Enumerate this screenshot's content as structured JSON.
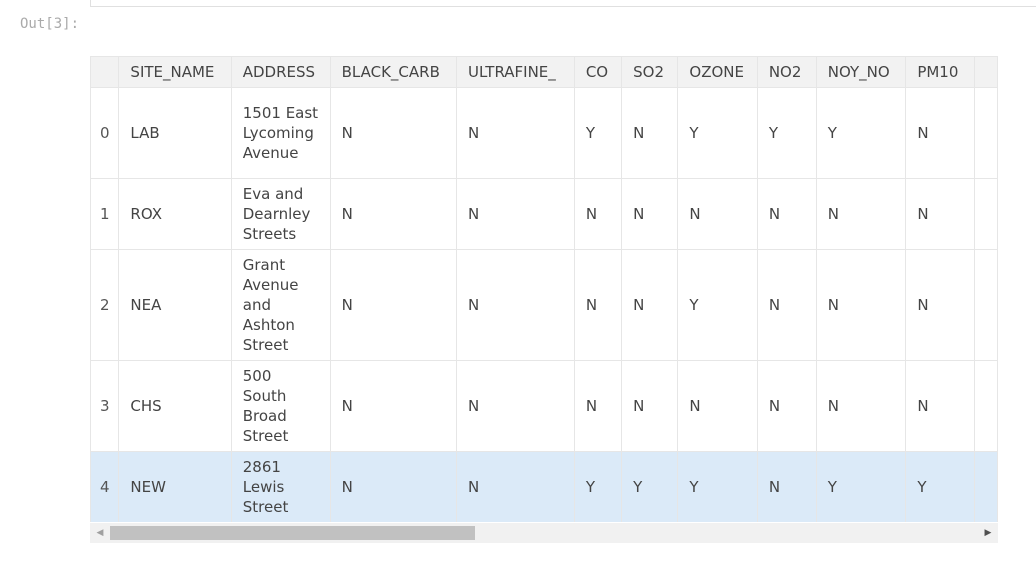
{
  "output_prompt": "Out[3]:",
  "table": {
    "columns": [
      "SITE_NAME",
      "ADDRESS",
      "BLACK_CARB",
      "ULTRAFINE_",
      "CO",
      "SO2",
      "OZONE",
      "NO2",
      "NOY_NO",
      "PM10"
    ],
    "rows": [
      {
        "index": "0",
        "cells": [
          "LAB",
          "1501 East Lycoming Avenue",
          "N",
          "N",
          "Y",
          "N",
          "Y",
          "Y",
          "Y",
          "N"
        ]
      },
      {
        "index": "1",
        "cells": [
          "ROX",
          "Eva and Dearnley Streets",
          "N",
          "N",
          "N",
          "N",
          "N",
          "N",
          "N",
          "N"
        ]
      },
      {
        "index": "2",
        "cells": [
          "NEA",
          "Grant Avenue and Ashton Street",
          "N",
          "N",
          "N",
          "N",
          "Y",
          "N",
          "N",
          "N"
        ]
      },
      {
        "index": "3",
        "cells": [
          "CHS",
          "500 South Broad Street",
          "N",
          "N",
          "N",
          "N",
          "N",
          "N",
          "N",
          "N"
        ]
      },
      {
        "index": "4",
        "cells": [
          "NEW",
          "2861 Lewis Street",
          "N",
          "N",
          "Y",
          "Y",
          "Y",
          "N",
          "Y",
          "Y"
        ]
      }
    ],
    "selected_row": "4"
  },
  "scrollbar": {
    "left_arrow_icon": "scroll-left-arrow-icon",
    "right_arrow_icon": "scroll-right-arrow-icon",
    "position_fraction": 0.0,
    "visible_fraction": 0.42
  },
  "colors": {
    "header_bg": "#f2f2f2",
    "selected_row_bg": "#dbeaf8",
    "border": "#e6e6e6",
    "prompt_text": "#aaaaaa"
  }
}
